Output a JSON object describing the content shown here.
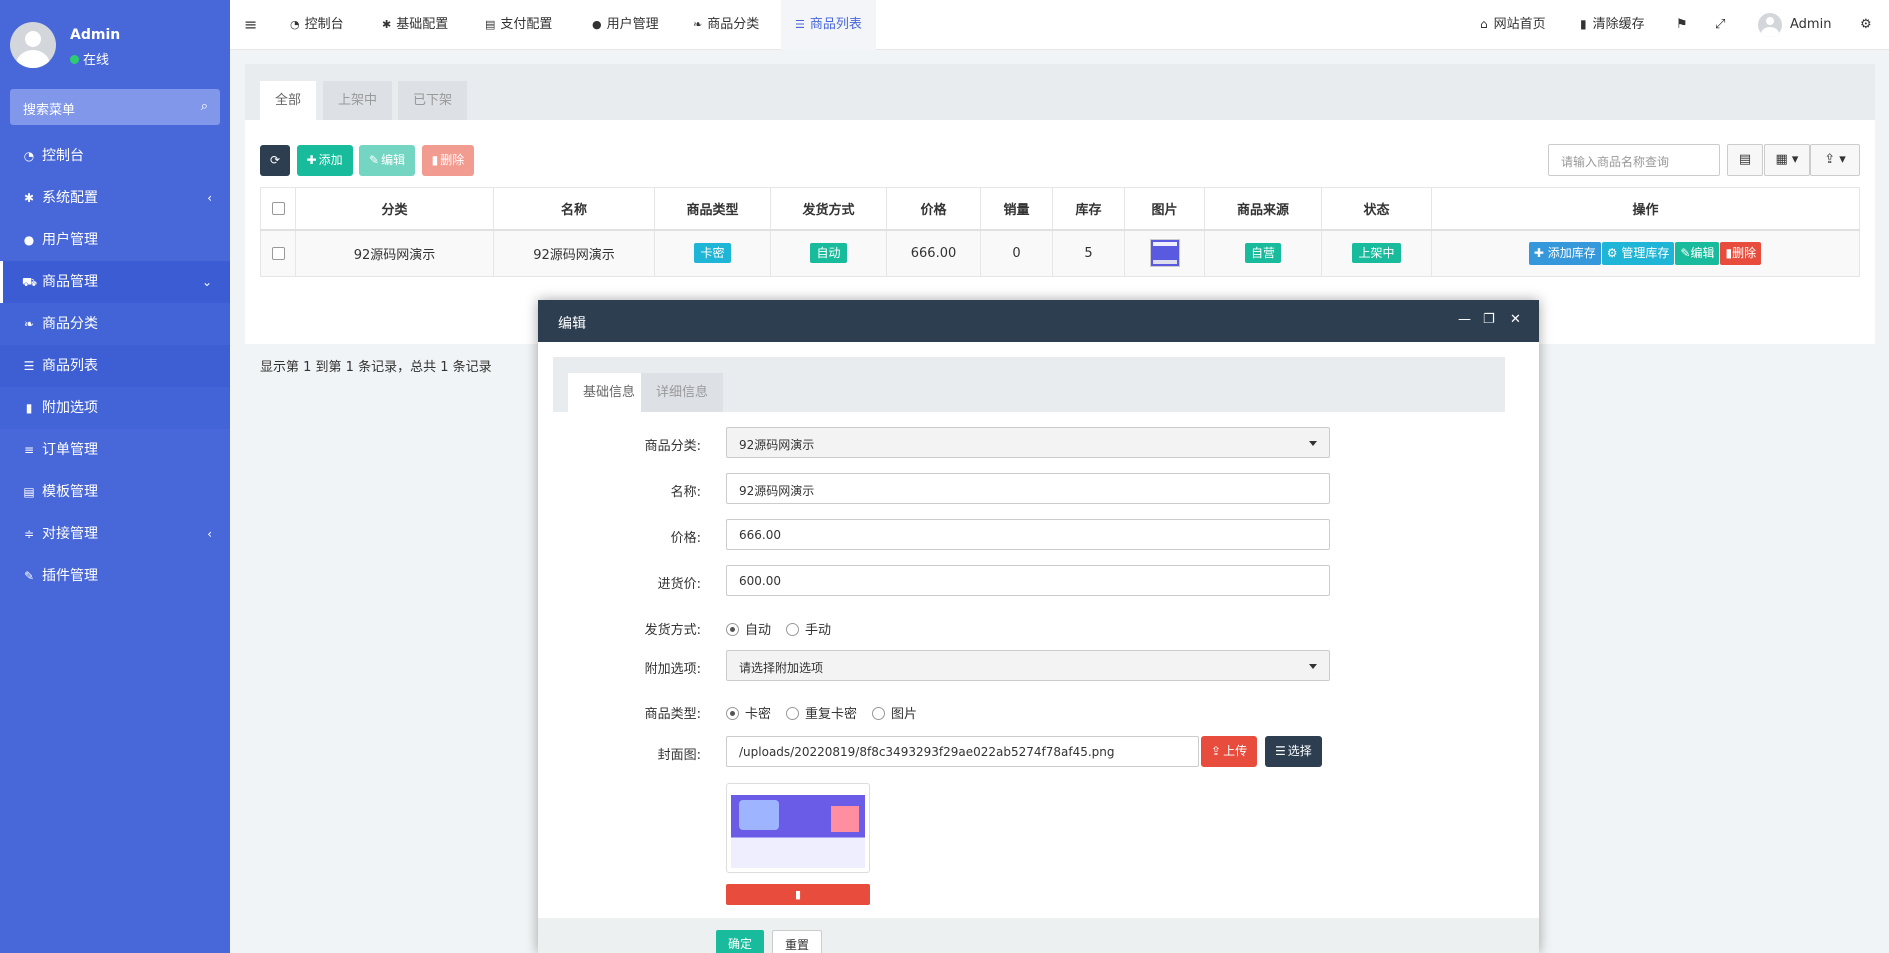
{
  "sidebar": {
    "user": {
      "name": "Admin",
      "status": "在线"
    },
    "search_label": "搜索菜单",
    "icons": {
      "search": "search-icon"
    },
    "items": [
      {
        "label": "控制台",
        "glyph": "◔",
        "icon": "dashboard-icon"
      },
      {
        "label": "系统配置",
        "glyph": "✱",
        "icon": "gear-icon",
        "arrow": "‹"
      },
      {
        "label": "用户管理",
        "glyph": "●",
        "icon": "user-icon"
      },
      {
        "label": "商品管理",
        "glyph": "⛟",
        "icon": "cart-icon",
        "arrow": "⌄"
      },
      {
        "label": "商品分类",
        "glyph": "❧",
        "icon": "leaf-icon"
      },
      {
        "label": "商品列表",
        "glyph": "☰",
        "icon": "list-icon"
      },
      {
        "label": "附加选项",
        "glyph": "▮",
        "icon": "bookmark-icon"
      },
      {
        "label": "订单管理",
        "glyph": "≡",
        "icon": "bars-icon"
      },
      {
        "label": "模板管理",
        "glyph": "▤",
        "icon": "template-icon"
      },
      {
        "label": "对接管理",
        "glyph": "≑",
        "icon": "sliders-icon",
        "arrow": "‹"
      },
      {
        "label": "插件管理",
        "glyph": "✎",
        "icon": "plug-icon"
      }
    ]
  },
  "topbar": {
    "menu_glyph": "≡",
    "tabs": [
      {
        "label": "控制台",
        "glyph": "◔"
      },
      {
        "label": "基础配置",
        "glyph": "✱"
      },
      {
        "label": "支付配置",
        "glyph": "▤"
      },
      {
        "label": "用户管理",
        "glyph": "●"
      },
      {
        "label": "商品分类",
        "glyph": "❧"
      },
      {
        "label": "商品列表",
        "glyph": "☰"
      }
    ],
    "home": "网站首页",
    "clear_cache": "清除缓存",
    "admin": "Admin",
    "home_glyph": "⌂",
    "trash_glyph": "▮",
    "lang_glyph": "⚑",
    "fullscreen_glyph": "⤢",
    "settings_glyph": "⚙"
  },
  "panel": {
    "tabs": [
      "全部",
      "上架中",
      "已下架"
    ],
    "toolbar": {
      "refresh_glyph": "⟳",
      "add": "添加",
      "edit": "编辑",
      "delete": "删除",
      "add_glyph": "✚",
      "edit_glyph": "✎",
      "delete_glyph": "▮"
    },
    "search_placeholder": "请输入商品名称查询",
    "view_glyphs": {
      "table": "▤",
      "columns": "▦ ▾",
      "export": "⇪ ▾"
    },
    "columns": [
      "分类",
      "名称",
      "商品类型",
      "发货方式",
      "价格",
      "销量",
      "库存",
      "图片",
      "商品来源",
      "状态",
      "操作"
    ],
    "rows": [
      {
        "category": "92源码网演示",
        "name": "92源码网演示",
        "type": "卡密",
        "delivery": "自动",
        "price": "666.00",
        "sales": "0",
        "stock": "5",
        "source": "自营",
        "status": "上架中",
        "ops": [
          "添加库存",
          "管理库存",
          "编辑",
          "删除"
        ]
      }
    ],
    "pagination": "显示第 1 到第 1 条记录，总共 1 条记录"
  },
  "modal": {
    "title": "编辑",
    "controls": {
      "min": "—",
      "max": "❐",
      "close": "✕"
    },
    "tabs": [
      "基础信息",
      "详细信息"
    ],
    "fields": {
      "category": {
        "label": "商品分类:",
        "value": "92源码网演示"
      },
      "name": {
        "label": "名称:",
        "value": "92源码网演示"
      },
      "price": {
        "label": "价格:",
        "value": "666.00"
      },
      "cost": {
        "label": "进货价:",
        "value": "600.00"
      },
      "delivery": {
        "label": "发货方式:",
        "options": [
          "自动",
          "手动"
        ],
        "selected": "自动"
      },
      "addon": {
        "label": "附加选项:",
        "placeholder": "请选择附加选项"
      },
      "type": {
        "label": "商品类型:",
        "options": [
          "卡密",
          "重复卡密",
          "图片"
        ],
        "selected": "卡密"
      },
      "cover": {
        "label": "封面图:",
        "value": "/uploads/20220819/8f8c3493293f29ae022ab5274f78af45.png",
        "upload": "上传",
        "choose": "选择",
        "upload_glyph": "⇪",
        "choose_glyph": "☰"
      }
    },
    "delete_glyph": "▮",
    "submit": "确定",
    "reset": "重置"
  },
  "colors": {
    "sidebar": "#4867d9",
    "primary": "#18bc9c",
    "danger": "#e74c3c",
    "dark": "#2c3e50",
    "info": "#1fb5d6",
    "blue": "#3498db"
  }
}
